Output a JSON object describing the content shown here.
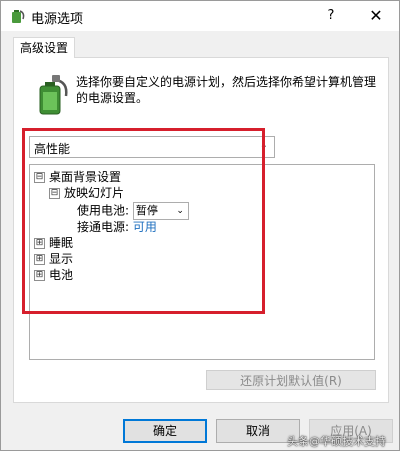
{
  "window": {
    "title": "电源选项",
    "help": "?",
    "close": "✕",
    "tab": "高级设置"
  },
  "description": "选择你要自定义的电源计划，然后选择你希望计算机管理的电源设置。",
  "plan": {
    "selected": "高性能",
    "arrow": "⌄"
  },
  "tree": {
    "collapse_symbol": "⊟",
    "expand_symbol": "⊞",
    "items": [
      {
        "label": "桌面背景设置"
      },
      {
        "label": "放映幻灯片"
      },
      {
        "label": "睡眠"
      },
      {
        "label": "显示"
      },
      {
        "label": "电池"
      }
    ],
    "battery_label": "使用电池:",
    "battery_value": "暂停",
    "ac_label": "接通电源:",
    "ac_value": "可用"
  },
  "buttons": {
    "restore": "还原计划默认值(R)",
    "ok": "确定",
    "cancel": "取消",
    "apply": "应用(A)"
  },
  "watermark": "头条@华硕技术支持",
  "colors": {
    "highlight": "#d61f2c",
    "link": "#1e6fbf",
    "focus": "#0078d7"
  }
}
